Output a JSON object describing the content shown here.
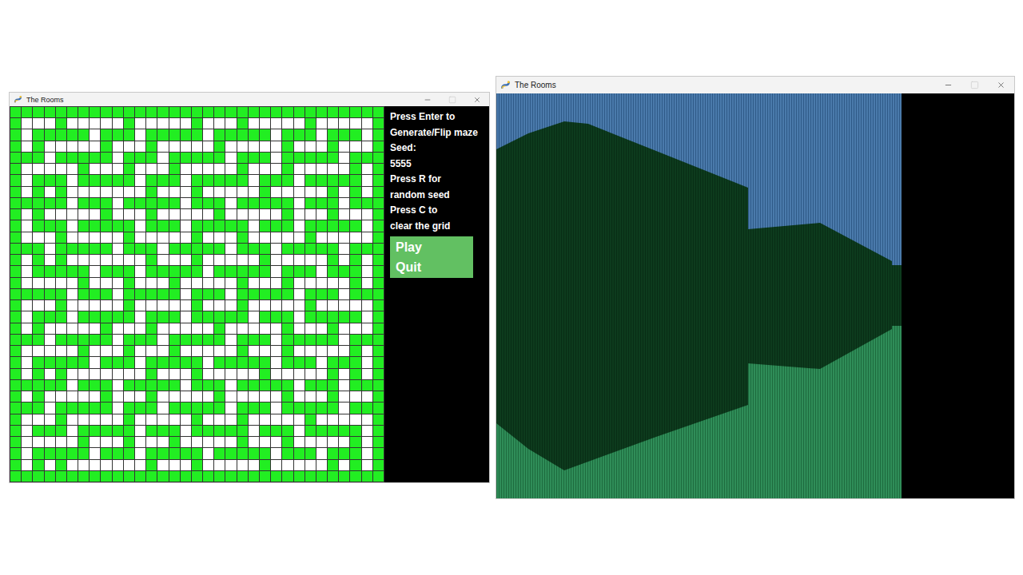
{
  "windows": [
    {
      "title": "The Rooms",
      "kind": "editor",
      "controls": [
        {
          "kind": "minimize",
          "disabled": false
        },
        {
          "kind": "maximize",
          "disabled": true
        },
        {
          "kind": "close",
          "disabled": false
        }
      ],
      "maze": {
        "rows": [
          [
            1,
            1,
            1,
            1,
            1,
            1,
            1,
            1,
            1,
            1,
            1,
            1,
            1,
            1,
            1,
            1,
            1,
            1,
            1,
            1,
            1,
            1,
            1,
            1,
            1,
            1,
            1,
            1,
            1,
            1,
            1,
            1,
            1
          ],
          [
            1,
            0,
            0,
            0,
            1,
            0,
            0,
            0,
            0,
            0,
            1,
            0,
            0,
            0,
            0,
            0,
            1,
            0,
            0,
            0,
            1,
            0,
            0,
            0,
            0,
            0,
            1,
            0,
            0,
            0,
            0,
            0,
            1
          ],
          [
            1,
            0,
            1,
            1,
            1,
            1,
            1,
            0,
            1,
            1,
            1,
            0,
            1,
            1,
            1,
            1,
            1,
            0,
            1,
            1,
            1,
            1,
            1,
            0,
            1,
            1,
            1,
            0,
            1,
            1,
            1,
            0,
            1
          ],
          [
            1,
            0,
            1,
            0,
            0,
            0,
            0,
            0,
            1,
            0,
            0,
            0,
            1,
            0,
            0,
            0,
            0,
            0,
            1,
            0,
            0,
            0,
            0,
            0,
            1,
            0,
            0,
            0,
            1,
            0,
            0,
            0,
            1
          ],
          [
            1,
            1,
            1,
            0,
            1,
            1,
            1,
            1,
            1,
            0,
            1,
            1,
            1,
            0,
            1,
            1,
            1,
            1,
            1,
            0,
            1,
            1,
            1,
            0,
            1,
            1,
            1,
            1,
            1,
            0,
            1,
            1,
            1
          ],
          [
            1,
            0,
            0,
            0,
            0,
            0,
            1,
            0,
            0,
            0,
            1,
            0,
            0,
            0,
            1,
            0,
            0,
            0,
            0,
            0,
            1,
            0,
            0,
            0,
            1,
            0,
            0,
            0,
            0,
            0,
            1,
            0,
            1
          ],
          [
            1,
            0,
            1,
            1,
            1,
            0,
            1,
            1,
            1,
            1,
            1,
            0,
            1,
            1,
            1,
            0,
            1,
            1,
            1,
            1,
            1,
            0,
            1,
            1,
            1,
            0,
            1,
            1,
            1,
            1,
            1,
            0,
            1
          ],
          [
            1,
            0,
            1,
            0,
            1,
            0,
            0,
            0,
            0,
            0,
            0,
            0,
            1,
            0,
            0,
            0,
            1,
            0,
            0,
            0,
            0,
            0,
            1,
            0,
            0,
            0,
            0,
            0,
            1,
            0,
            1,
            0,
            1
          ],
          [
            1,
            1,
            1,
            1,
            1,
            0,
            1,
            1,
            1,
            0,
            1,
            1,
            1,
            1,
            1,
            0,
            1,
            1,
            1,
            0,
            1,
            1,
            1,
            1,
            1,
            0,
            1,
            1,
            1,
            0,
            1,
            1,
            1
          ],
          [
            1,
            0,
            1,
            0,
            0,
            0,
            0,
            0,
            1,
            0,
            0,
            0,
            1,
            0,
            0,
            0,
            0,
            0,
            1,
            0,
            0,
            0,
            0,
            0,
            1,
            0,
            0,
            0,
            1,
            0,
            0,
            0,
            1
          ],
          [
            1,
            0,
            1,
            1,
            1,
            0,
            1,
            1,
            1,
            1,
            1,
            0,
            1,
            1,
            1,
            0,
            1,
            1,
            1,
            1,
            1,
            0,
            1,
            1,
            1,
            0,
            1,
            1,
            1,
            1,
            1,
            0,
            1
          ],
          [
            1,
            0,
            0,
            0,
            1,
            0,
            0,
            0,
            0,
            0,
            1,
            0,
            0,
            0,
            0,
            0,
            1,
            0,
            0,
            0,
            1,
            0,
            0,
            0,
            0,
            0,
            1,
            0,
            0,
            0,
            0,
            0,
            1
          ],
          [
            1,
            1,
            1,
            0,
            1,
            1,
            1,
            1,
            1,
            0,
            1,
            1,
            1,
            0,
            1,
            1,
            1,
            1,
            1,
            0,
            1,
            1,
            1,
            0,
            1,
            1,
            1,
            1,
            1,
            0,
            1,
            1,
            1
          ],
          [
            1,
            0,
            1,
            0,
            1,
            0,
            0,
            0,
            0,
            0,
            0,
            0,
            1,
            0,
            0,
            0,
            1,
            0,
            0,
            0,
            0,
            0,
            1,
            0,
            0,
            0,
            0,
            0,
            1,
            0,
            1,
            0,
            1
          ],
          [
            1,
            0,
            1,
            1,
            1,
            1,
            1,
            0,
            1,
            1,
            1,
            0,
            1,
            1,
            1,
            1,
            1,
            0,
            1,
            1,
            1,
            1,
            1,
            0,
            1,
            1,
            1,
            0,
            1,
            1,
            1,
            0,
            1
          ],
          [
            1,
            0,
            0,
            0,
            0,
            0,
            1,
            0,
            0,
            0,
            1,
            0,
            0,
            0,
            1,
            0,
            0,
            0,
            0,
            0,
            1,
            0,
            0,
            0,
            1,
            0,
            0,
            0,
            0,
            0,
            1,
            0,
            1
          ],
          [
            1,
            1,
            1,
            1,
            1,
            0,
            1,
            1,
            1,
            0,
            1,
            1,
            1,
            1,
            1,
            0,
            1,
            1,
            1,
            0,
            1,
            1,
            1,
            1,
            1,
            0,
            1,
            1,
            1,
            0,
            1,
            1,
            1
          ],
          [
            1,
            0,
            0,
            0,
            1,
            0,
            0,
            0,
            0,
            0,
            1,
            0,
            0,
            0,
            0,
            0,
            1,
            0,
            0,
            0,
            1,
            0,
            0,
            0,
            0,
            0,
            1,
            0,
            0,
            0,
            0,
            0,
            1
          ],
          [
            1,
            0,
            1,
            1,
            1,
            0,
            1,
            1,
            1,
            1,
            1,
            0,
            1,
            1,
            1,
            0,
            1,
            1,
            1,
            1,
            1,
            0,
            1,
            1,
            1,
            0,
            1,
            1,
            1,
            1,
            1,
            0,
            1
          ],
          [
            1,
            0,
            1,
            0,
            0,
            0,
            0,
            0,
            1,
            0,
            0,
            0,
            1,
            0,
            0,
            0,
            0,
            0,
            1,
            0,
            0,
            0,
            0,
            0,
            1,
            0,
            0,
            0,
            1,
            0,
            0,
            0,
            1
          ],
          [
            1,
            1,
            1,
            0,
            1,
            1,
            1,
            1,
            1,
            0,
            1,
            1,
            1,
            0,
            1,
            1,
            1,
            1,
            1,
            0,
            1,
            1,
            1,
            0,
            1,
            1,
            1,
            1,
            1,
            0,
            1,
            1,
            1
          ],
          [
            1,
            0,
            0,
            0,
            0,
            0,
            1,
            0,
            0,
            0,
            1,
            0,
            0,
            0,
            1,
            0,
            0,
            0,
            0,
            0,
            1,
            0,
            0,
            0,
            1,
            0,
            0,
            0,
            0,
            0,
            1,
            0,
            1
          ],
          [
            1,
            0,
            1,
            1,
            1,
            1,
            1,
            0,
            1,
            1,
            1,
            0,
            1,
            1,
            1,
            1,
            1,
            0,
            1,
            1,
            1,
            1,
            1,
            0,
            1,
            1,
            1,
            0,
            1,
            1,
            1,
            0,
            1
          ],
          [
            1,
            0,
            1,
            0,
            1,
            0,
            0,
            0,
            0,
            0,
            0,
            0,
            1,
            0,
            0,
            0,
            1,
            0,
            0,
            0,
            0,
            0,
            1,
            0,
            0,
            0,
            0,
            0,
            1,
            0,
            1,
            0,
            1
          ],
          [
            1,
            1,
            1,
            1,
            1,
            0,
            1,
            1,
            1,
            0,
            1,
            1,
            1,
            1,
            1,
            0,
            1,
            1,
            1,
            0,
            1,
            1,
            1,
            1,
            1,
            0,
            1,
            1,
            1,
            0,
            1,
            1,
            1
          ],
          [
            1,
            0,
            1,
            0,
            0,
            0,
            0,
            0,
            1,
            0,
            0,
            0,
            1,
            0,
            0,
            0,
            0,
            0,
            1,
            0,
            0,
            0,
            0,
            0,
            1,
            0,
            0,
            0,
            1,
            0,
            0,
            0,
            1
          ],
          [
            1,
            1,
            1,
            0,
            1,
            1,
            1,
            1,
            1,
            0,
            1,
            1,
            1,
            0,
            1,
            1,
            1,
            1,
            1,
            0,
            1,
            1,
            1,
            0,
            1,
            1,
            1,
            1,
            1,
            0,
            1,
            1,
            1
          ],
          [
            1,
            0,
            0,
            0,
            1,
            0,
            0,
            0,
            0,
            0,
            1,
            0,
            0,
            0,
            0,
            0,
            1,
            0,
            0,
            0,
            1,
            0,
            0,
            0,
            0,
            0,
            1,
            0,
            0,
            0,
            0,
            0,
            1
          ],
          [
            1,
            0,
            1,
            1,
            1,
            0,
            1,
            1,
            1,
            1,
            1,
            0,
            1,
            1,
            1,
            0,
            1,
            1,
            1,
            1,
            1,
            0,
            1,
            1,
            1,
            0,
            1,
            1,
            1,
            1,
            1,
            0,
            1
          ],
          [
            1,
            0,
            0,
            0,
            0,
            0,
            1,
            0,
            0,
            0,
            1,
            0,
            0,
            0,
            1,
            0,
            0,
            0,
            0,
            0,
            1,
            0,
            0,
            0,
            1,
            0,
            0,
            0,
            0,
            0,
            1,
            0,
            1
          ],
          [
            1,
            0,
            1,
            1,
            1,
            1,
            1,
            0,
            1,
            1,
            1,
            0,
            1,
            1,
            1,
            1,
            1,
            0,
            1,
            1,
            1,
            1,
            1,
            0,
            1,
            1,
            1,
            0,
            1,
            1,
            1,
            0,
            1
          ],
          [
            1,
            0,
            1,
            0,
            1,
            0,
            0,
            0,
            0,
            0,
            0,
            0,
            1,
            0,
            0,
            0,
            1,
            0,
            0,
            0,
            0,
            0,
            1,
            0,
            0,
            0,
            0,
            0,
            1,
            0,
            1,
            0,
            1
          ],
          [
            1,
            1,
            1,
            1,
            1,
            1,
            1,
            1,
            1,
            1,
            1,
            1,
            1,
            1,
            1,
            1,
            1,
            1,
            1,
            1,
            1,
            1,
            1,
            1,
            1,
            1,
            1,
            1,
            1,
            1,
            1,
            1,
            1
          ]
        ]
      },
      "sidebar": {
        "lines": [
          "Press Enter to",
          "Generate/Flip maze",
          "Seed:",
          "5555",
          "Press R for",
          "random seed",
          "Press C to",
          "clear the grid"
        ],
        "menu": [
          {
            "label": "Play"
          },
          {
            "label": "Quit"
          }
        ]
      }
    },
    {
      "title": "The Rooms",
      "kind": "view",
      "controls": [
        {
          "kind": "minimize",
          "disabled": false
        },
        {
          "kind": "maximize",
          "disabled": true
        },
        {
          "kind": "close",
          "disabled": false
        }
      ]
    }
  ]
}
